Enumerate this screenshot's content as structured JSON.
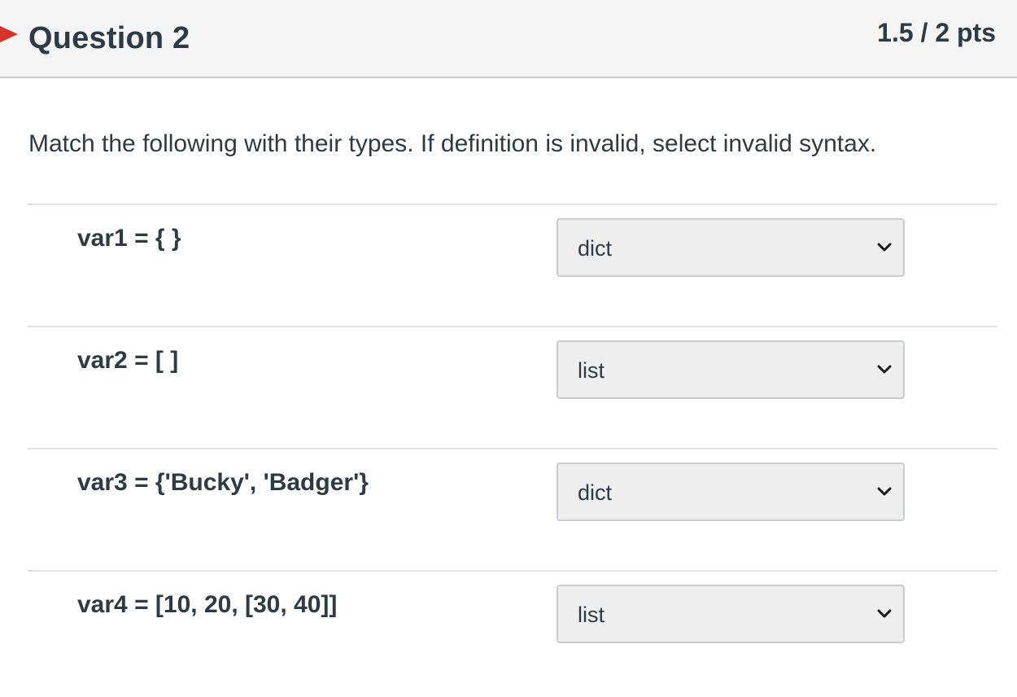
{
  "question": {
    "title": "Question 2",
    "points": "1.5 / 2 pts",
    "status_color": "#d9342b",
    "prompt": "Match the following with their types. If definition is invalid, select invalid syntax."
  },
  "answers": [
    {
      "label": "var1 = { }",
      "selected": "dict"
    },
    {
      "label": "var2 = [ ]",
      "selected": "list"
    },
    {
      "label": "var3 = {'Bucky', 'Badger'}",
      "selected": "dict"
    },
    {
      "label": "var4 = [10, 20, [30, 40]]",
      "selected": "list"
    }
  ],
  "icons": {
    "status": "incorrect-marker-icon",
    "dropdown": "chevron-down-icon"
  }
}
